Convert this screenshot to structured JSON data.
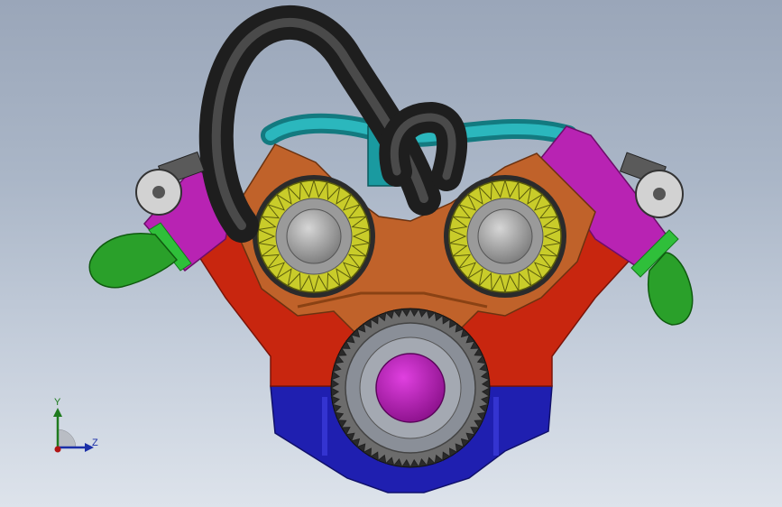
{
  "viewport": {
    "background_top": "#9aa6b9",
    "background_bottom": "#dde3eb"
  },
  "model": {
    "name": "v-twin-engine-assembly",
    "colors": {
      "crankcase_upper": "#c8260f",
      "crankcase_lower": "#1f1fb0",
      "cylinder_head": "#b823b3",
      "valley_cover": "#c0622a",
      "intake_hose": "#2b2b2b",
      "coolant_pipe": "#1e9aa0",
      "exhaust_elbow": "#2aa02a",
      "flange_ring": "#2fbf3a",
      "gear_teeth": "#c9cc2a",
      "gear_hub": "#9a9a9a",
      "flywheel_hub": "#c21ac2",
      "flywheel_ring": "#8a8f98"
    }
  },
  "triad": {
    "y_axis_label": "Y",
    "z_axis_label": "Z",
    "y_color": "#1e7a1e",
    "z_color": "#1b2fa8",
    "x_color": "#b01414"
  }
}
